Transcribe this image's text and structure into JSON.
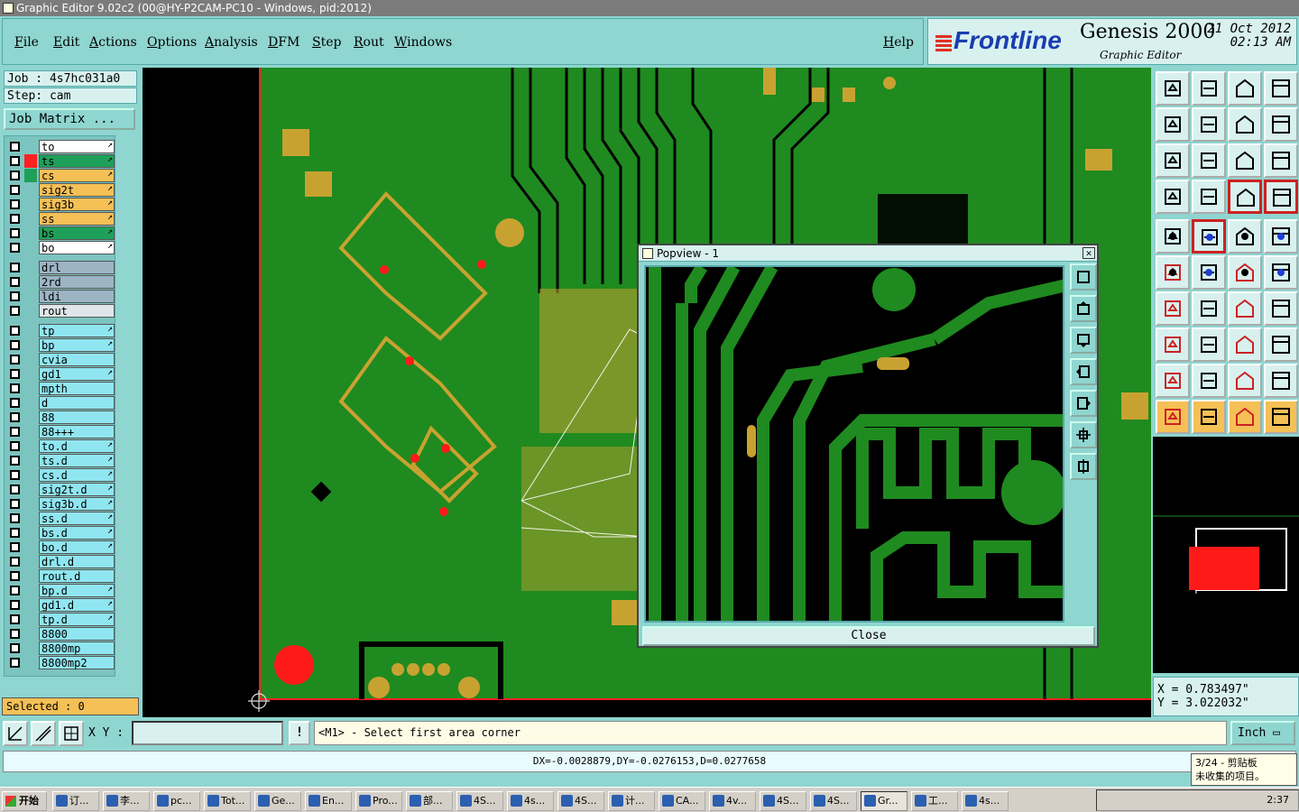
{
  "window": {
    "title": "Graphic Editor 9.02c2 (00@HY-P2CAM-PC10 - Windows, pid:2012)"
  },
  "menu": [
    "File",
    "Edit",
    "Actions",
    "Options",
    "Analysis",
    "DFM",
    "Step",
    "Rout",
    "Windows"
  ],
  "help_label": "Help",
  "brand": {
    "logo": "Frontline",
    "product": "Genesis 2000",
    "subtitle": "Graphic Editor",
    "date": "21 Oct 2012",
    "time": "02:13 AM"
  },
  "job": {
    "job_label": "Job : 4s7hc031a0",
    "step_label": "Step: cam",
    "job_matrix_label": "Job Matrix ..."
  },
  "layers": [
    {
      "name": "to",
      "color": "#ffffff",
      "swatch": "",
      "arrow": true
    },
    {
      "name": "ts",
      "color": "#1fa05a",
      "swatch": "#ff2020",
      "arrow": true
    },
    {
      "name": "cs",
      "color": "#f5c056",
      "swatch": "#1fa05a",
      "arrow": true
    },
    {
      "name": "sig2t",
      "color": "#f5c056",
      "swatch": "",
      "arrow": true
    },
    {
      "name": "sig3b",
      "color": "#f5c056",
      "swatch": "",
      "arrow": true
    },
    {
      "name": "ss",
      "color": "#f5c056",
      "swatch": "",
      "arrow": true
    },
    {
      "name": "bs",
      "color": "#1fa05a",
      "swatch": "",
      "arrow": true
    },
    {
      "name": "bo",
      "color": "#ffffff",
      "swatch": "",
      "arrow": true
    },
    {
      "name": "drl",
      "color": "#9cb4c4",
      "swatch": "",
      "arrow": false
    },
    {
      "name": "2rd",
      "color": "#9cb4c4",
      "swatch": "",
      "arrow": false
    },
    {
      "name": "ldi",
      "color": "#9cb4c4",
      "swatch": "",
      "arrow": false
    },
    {
      "name": "rout",
      "color": "#dfe5e8",
      "swatch": "",
      "arrow": false
    },
    {
      "name": "tp",
      "color": "#8fe6f0",
      "swatch": "",
      "arrow": true
    },
    {
      "name": "bp",
      "color": "#8fe6f0",
      "swatch": "",
      "arrow": true
    },
    {
      "name": "cvia",
      "color": "#8fe6f0",
      "swatch": "",
      "arrow": false
    },
    {
      "name": "gd1",
      "color": "#8fe6f0",
      "swatch": "",
      "arrow": true
    },
    {
      "name": "mpth",
      "color": "#8fe6f0",
      "swatch": "",
      "arrow": false
    },
    {
      "name": "d",
      "color": "#8fe6f0",
      "swatch": "",
      "arrow": false
    },
    {
      "name": "88",
      "color": "#8fe6f0",
      "swatch": "",
      "arrow": false
    },
    {
      "name": "88+++",
      "color": "#8fe6f0",
      "swatch": "",
      "arrow": false
    },
    {
      "name": "to.d",
      "color": "#8fe6f0",
      "swatch": "",
      "arrow": true
    },
    {
      "name": "ts.d",
      "color": "#8fe6f0",
      "swatch": "",
      "arrow": true
    },
    {
      "name": "cs.d",
      "color": "#8fe6f0",
      "swatch": "",
      "arrow": true
    },
    {
      "name": "sig2t.d",
      "color": "#8fe6f0",
      "swatch": "",
      "arrow": true
    },
    {
      "name": "sig3b.d",
      "color": "#8fe6f0",
      "swatch": "",
      "arrow": true
    },
    {
      "name": "ss.d",
      "color": "#8fe6f0",
      "swatch": "",
      "arrow": true
    },
    {
      "name": "bs.d",
      "color": "#8fe6f0",
      "swatch": "",
      "arrow": true
    },
    {
      "name": "bo.d",
      "color": "#8fe6f0",
      "swatch": "",
      "arrow": true
    },
    {
      "name": "drl.d",
      "color": "#8fe6f0",
      "swatch": "",
      "arrow": false
    },
    {
      "name": "rout.d",
      "color": "#8fe6f0",
      "swatch": "",
      "arrow": false
    },
    {
      "name": "bp.d",
      "color": "#8fe6f0",
      "swatch": "",
      "arrow": true
    },
    {
      "name": "gd1.d",
      "color": "#8fe6f0",
      "swatch": "",
      "arrow": true
    },
    {
      "name": "tp.d",
      "color": "#8fe6f0",
      "swatch": "",
      "arrow": true
    },
    {
      "name": "8800",
      "color": "#8fe6f0",
      "swatch": "",
      "arrow": false
    },
    {
      "name": "8800mp",
      "color": "#8fe6f0",
      "swatch": "",
      "arrow": false
    },
    {
      "name": "8800mp2",
      "color": "#8fe6f0",
      "swatch": "",
      "arrow": false
    }
  ],
  "selected_label": "Selected : 0",
  "popview": {
    "title": "Popview - 1",
    "close_label": "Close"
  },
  "coords": {
    "x": "X = 0.783497\"",
    "y": "Y = 3.022032\""
  },
  "status": {
    "xy_label": "X Y :",
    "xy_value": "",
    "prompt": "<M1> - Select first area corner",
    "units": "Inch",
    "delta": "DX=-0.0028879,DY=-0.0276153,D=0.0277658"
  },
  "tooltip": {
    "line1": "3/24 - 剪贴板",
    "line2": "未收集的项目。"
  },
  "taskbar": {
    "start": "开始",
    "tasks": [
      "订...",
      "李...",
      "pc...",
      "Tot...",
      "Ge...",
      "En...",
      "Pro...",
      "部...",
      "4S...",
      "4s...",
      "4S...",
      "计...",
      "CA...",
      "4v...",
      "4S...",
      "4S...",
      "Gr...",
      "工...",
      "4s..."
    ],
    "active_task": "Gr...",
    "clock": "2:37"
  },
  "colors": {
    "board": "#1f8a1f",
    "copper": "#c8a231",
    "via": "#ff1a1a",
    "panel": "#8fd5d0",
    "panel_light": "#d8f1ef"
  }
}
